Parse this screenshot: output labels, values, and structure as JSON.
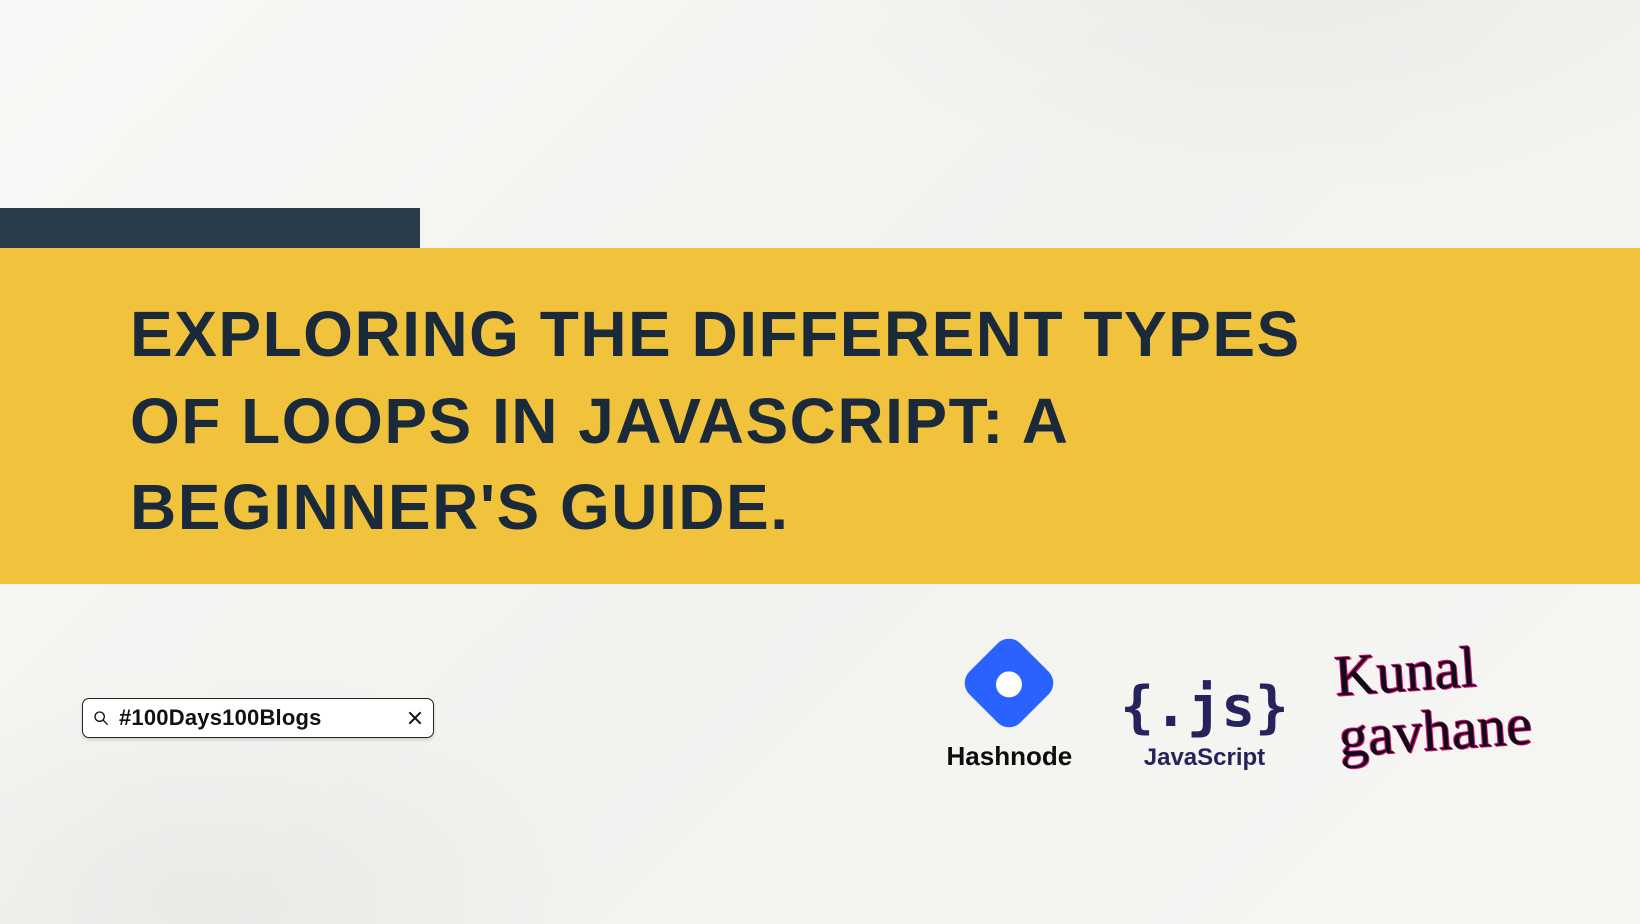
{
  "colors": {
    "accent_yellow": "#f1c33c",
    "dark_navy": "#2a3b4a",
    "hashnode_blue": "#2962ff",
    "js_purple": "#26235c",
    "signature_pink": "#e10b7a"
  },
  "title": "EXPLORING THE DIFFERENT TYPES OF LOOPS IN JAVASCRIPT: A BEGINNER'S GUIDE.",
  "search": {
    "value": "#100Days100Blogs"
  },
  "logos": {
    "hashnode_label": "Hashnode",
    "js_brace": "{.js}",
    "js_label": "JavaScript"
  },
  "signature": {
    "line1": "Kunal",
    "line2": "gavhane"
  }
}
